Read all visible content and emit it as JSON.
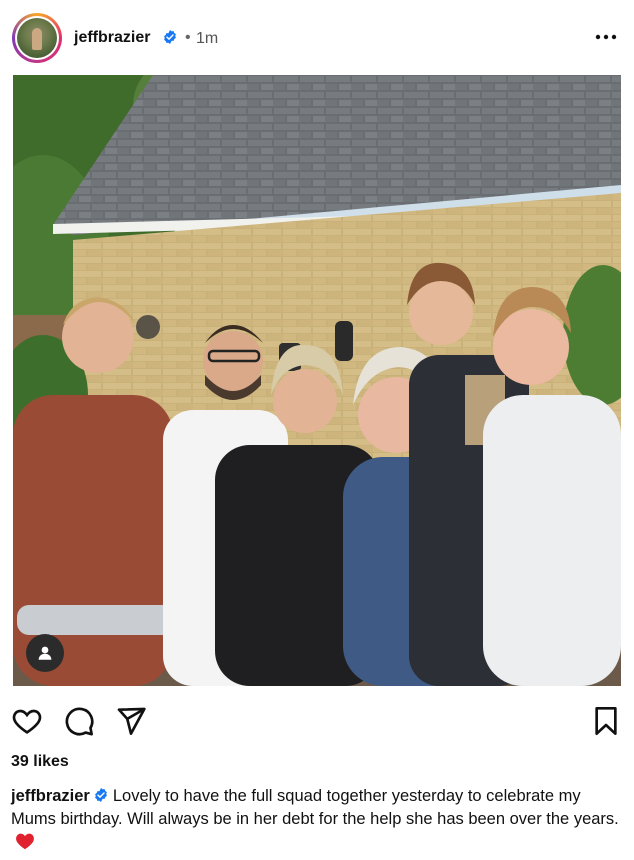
{
  "post": {
    "username": "jeffbrazier",
    "time_ago": "1m",
    "separator": "•",
    "likes": "39 likes",
    "caption": "Lovely to have the full squad together yesterday to celebrate my Mums birthday. Will always be in her debt for the help she has been over the years.",
    "caption_emoji": "red-heart-icon",
    "photo_description_icon": "person-tag-icon"
  },
  "icons": {
    "verified": "verified-badge-icon",
    "more": "more-options-icon",
    "like": "heart-outline-icon",
    "comment": "comment-icon",
    "share": "send-icon",
    "save": "bookmark-icon"
  },
  "colors": {
    "verified": "#1877f2",
    "heart": "#e0212e"
  }
}
